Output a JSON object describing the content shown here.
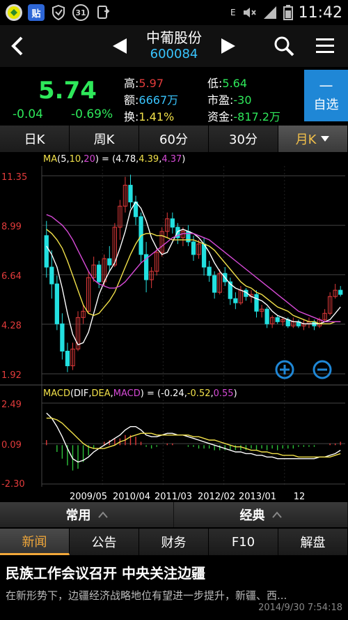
{
  "statusbar": {
    "time": "11:42",
    "notif_count": "31",
    "app_icon_text": "贴",
    "e_label": "E"
  },
  "title": {
    "stock_name": "中葡股份",
    "stock_code": "600084"
  },
  "quote": {
    "price": "5.74",
    "change": "-0.04",
    "change_pct": "-0.69%",
    "high_label": "高:",
    "high": "5.97",
    "low_label": "低:",
    "low": "5.64",
    "amount_label": "额:",
    "amount": "6667万",
    "pe_label": "市盈:",
    "pe": "-30",
    "turnover_label": "换:",
    "turnover": "1.41%",
    "fund_label": "资金:",
    "fund": "-817.2万",
    "zixuan_dash": "—",
    "zixuan_label": "自选"
  },
  "period_tabs": [
    "日K",
    "周K",
    "60分",
    "30分",
    "月K"
  ],
  "active_period": "月K",
  "colors": {
    "up": "#e23b3b",
    "down": "#23e0e0",
    "green": "#2ee85a",
    "accent": "#f2c04a",
    "blue": "#1f87d6"
  },
  "chart_data": [
    {
      "type": "candlestick",
      "title": "MA(5,10,20) = (4.78,4.39,4.37)",
      "ma_label": "MA",
      "ma_params": [
        "5",
        "10",
        "20"
      ],
      "ma_values": [
        "4.78",
        "4.39",
        "4.37"
      ],
      "y_ticks": [
        "11.35",
        "8.99",
        "6.64",
        "4.28",
        "1.92"
      ],
      "ylim": [
        1.92,
        11.35
      ],
      "x_ticks": [
        "2009/05",
        "2010/04",
        "2011/03",
        "2012/02",
        "2013/01",
        "12"
      ],
      "candles": [
        [
          8.5,
          9.2,
          6.5,
          7.0
        ],
        [
          7.0,
          7.8,
          5.5,
          6.2
        ],
        [
          6.2,
          6.6,
          4.0,
          4.3
        ],
        [
          4.3,
          4.8,
          2.6,
          3.0
        ],
        [
          3.0,
          3.4,
          2.0,
          2.3
        ],
        [
          2.3,
          3.4,
          2.1,
          3.1
        ],
        [
          3.1,
          4.9,
          3.0,
          4.6
        ],
        [
          4.6,
          5.2,
          4.3,
          4.9
        ],
        [
          4.9,
          6.8,
          4.8,
          6.5
        ],
        [
          6.5,
          7.5,
          6.3,
          7.1
        ],
        [
          7.1,
          7.3,
          6.0,
          6.3
        ],
        [
          6.3,
          7.6,
          6.1,
          7.4
        ],
        [
          7.4,
          8.0,
          6.8,
          7.1
        ],
        [
          7.1,
          9.1,
          7.0,
          8.9
        ],
        [
          8.9,
          10.2,
          8.3,
          9.9
        ],
        [
          9.9,
          11.3,
          9.6,
          10.9
        ],
        [
          10.9,
          11.4,
          9.8,
          10.1
        ],
        [
          10.1,
          10.4,
          9.0,
          9.4
        ],
        [
          9.4,
          9.6,
          7.2,
          7.6
        ],
        [
          7.6,
          8.2,
          5.8,
          6.4
        ],
        [
          6.4,
          7.0,
          6.0,
          6.8
        ],
        [
          6.8,
          7.9,
          6.6,
          7.7
        ],
        [
          7.7,
          8.9,
          7.5,
          8.7
        ],
        [
          8.7,
          9.6,
          8.4,
          9.3
        ],
        [
          9.3,
          9.6,
          8.6,
          8.9
        ],
        [
          8.9,
          9.1,
          8.1,
          8.4
        ],
        [
          8.4,
          8.9,
          8.0,
          8.7
        ],
        [
          8.7,
          9.0,
          8.0,
          8.2
        ],
        [
          8.2,
          8.5,
          7.3,
          7.6
        ],
        [
          7.6,
          8.3,
          7.4,
          8.1
        ],
        [
          8.1,
          8.4,
          6.6,
          7.0
        ],
        [
          7.0,
          7.3,
          6.3,
          6.6
        ],
        [
          6.6,
          6.8,
          5.5,
          5.8
        ],
        [
          5.8,
          6.9,
          5.7,
          6.7
        ],
        [
          6.7,
          7.0,
          6.1,
          6.3
        ],
        [
          6.3,
          6.5,
          5.2,
          5.5
        ],
        [
          5.5,
          5.8,
          5.0,
          5.3
        ],
        [
          5.3,
          6.1,
          5.2,
          5.9
        ],
        [
          5.9,
          6.0,
          5.4,
          5.6
        ],
        [
          5.6,
          5.9,
          5.3,
          5.7
        ],
        [
          5.7,
          5.9,
          4.6,
          4.9
        ],
        [
          4.9,
          5.2,
          4.6,
          5.0
        ],
        [
          5.0,
          5.1,
          4.1,
          4.3
        ],
        [
          4.3,
          4.7,
          4.1,
          4.6
        ],
        [
          4.6,
          4.7,
          4.3,
          4.4
        ],
        [
          4.4,
          4.6,
          4.2,
          4.5
        ],
        [
          4.5,
          4.6,
          4.1,
          4.2
        ],
        [
          4.2,
          4.6,
          4.1,
          4.4
        ],
        [
          4.4,
          4.5,
          4.1,
          4.2
        ],
        [
          4.2,
          4.5,
          4.0,
          4.3
        ],
        [
          4.3,
          4.6,
          4.1,
          4.4
        ],
        [
          4.4,
          4.5,
          4.0,
          4.2
        ],
        [
          4.2,
          4.6,
          4.1,
          4.5
        ],
        [
          4.5,
          5.0,
          4.4,
          4.8
        ],
        [
          4.8,
          5.8,
          4.7,
          5.6
        ],
        [
          5.6,
          6.2,
          5.5,
          5.9
        ],
        [
          5.9,
          6.1,
          5.6,
          5.7
        ]
      ],
      "ma5": [
        8.0,
        7.6,
        7.0,
        6.0,
        4.8,
        3.8,
        3.3,
        3.4,
        3.9,
        4.8,
        5.7,
        6.3,
        6.8,
        7.2,
        7.9,
        8.7,
        9.7,
        10.1,
        9.8,
        9.2,
        8.4,
        7.9,
        7.6,
        7.7,
        8.2,
        8.7,
        8.8,
        8.7,
        8.6,
        8.4,
        8.1,
        7.7,
        7.2,
        6.8,
        6.5,
        6.2,
        6.0,
        5.9,
        5.8,
        5.6,
        5.5,
        5.4,
        5.2,
        4.9,
        4.7,
        4.6,
        4.5,
        4.4,
        4.4,
        4.3,
        4.3,
        4.3,
        4.3,
        4.4,
        4.5,
        4.8,
        5.1
      ],
      "ma10": [
        8.8,
        8.6,
        8.3,
        7.9,
        7.3,
        6.6,
        5.9,
        5.2,
        4.8,
        4.7,
        4.8,
        5.1,
        5.4,
        5.8,
        6.4,
        7.0,
        7.6,
        8.1,
        8.5,
        8.6,
        8.6,
        8.5,
        8.5,
        8.4,
        8.3,
        8.3,
        8.3,
        8.3,
        8.3,
        8.2,
        8.1,
        8.0,
        7.8,
        7.5,
        7.2,
        6.9,
        6.6,
        6.3,
        6.1,
        6.0,
        5.8,
        5.7,
        5.5,
        5.3,
        5.1,
        5.0,
        4.9,
        4.7,
        4.6,
        4.5,
        4.4,
        4.4,
        4.3,
        4.3,
        4.3,
        4.4,
        4.4
      ],
      "ma20": [
        9.5,
        9.4,
        9.2,
        9.0,
        8.7,
        8.3,
        7.8,
        7.3,
        6.8,
        6.4,
        6.2,
        6.1,
        6.0,
        6.0,
        6.1,
        6.3,
        6.6,
        6.9,
        7.2,
        7.4,
        7.6,
        7.8,
        8.0,
        8.2,
        8.4,
        8.5,
        8.6,
        8.6,
        8.6,
        8.5,
        8.4,
        8.3,
        8.1,
        7.9,
        7.7,
        7.5,
        7.3,
        7.1,
        6.9,
        6.7,
        6.5,
        6.3,
        6.1,
        5.9,
        5.7,
        5.5,
        5.3,
        5.1,
        4.9,
        4.8,
        4.7,
        4.6,
        4.5,
        4.4,
        4.4,
        4.4,
        4.4
      ]
    },
    {
      "type": "macd",
      "title": "MACD(DIF,DEA,MACD) = (-0.24,-0.52,0.55)",
      "macd_label": "MACD",
      "macd_params": [
        "DIF",
        "DEA",
        "MACD"
      ],
      "macd_values": [
        "-0.24",
        "-0.52",
        "0.55"
      ],
      "y_ticks": [
        "2.49",
        "0.09",
        "-2.30"
      ],
      "ylim": [
        -2.3,
        2.49
      ],
      "dif": [
        1.9,
        1.6,
        1.1,
        0.5,
        -0.2,
        -0.8,
        -1.0,
        -0.9,
        -0.7,
        -0.4,
        -0.2,
        0.0,
        0.2,
        0.4,
        0.6,
        0.9,
        1.1,
        1.1,
        0.9,
        0.6,
        0.5,
        0.5,
        0.6,
        0.7,
        0.7,
        0.6,
        0.6,
        0.5,
        0.4,
        0.3,
        0.2,
        0.1,
        0.0,
        -0.1,
        -0.2,
        -0.3,
        -0.4,
        -0.4,
        -0.5,
        -0.5,
        -0.6,
        -0.6,
        -0.7,
        -0.7,
        -0.8,
        -0.8,
        -0.8,
        -0.8,
        -0.8,
        -0.8,
        -0.8,
        -0.8,
        -0.7,
        -0.7,
        -0.6,
        -0.5,
        -0.3
      ],
      "dea": [
        1.6,
        1.6,
        1.5,
        1.3,
        1.0,
        0.7,
        0.4,
        0.1,
        -0.1,
        -0.2,
        -0.2,
        -0.2,
        -0.1,
        0.0,
        0.2,
        0.3,
        0.5,
        0.6,
        0.7,
        0.7,
        0.7,
        0.6,
        0.6,
        0.6,
        0.6,
        0.6,
        0.6,
        0.6,
        0.5,
        0.5,
        0.4,
        0.3,
        0.3,
        0.2,
        0.1,
        0.0,
        -0.1,
        -0.1,
        -0.2,
        -0.3,
        -0.3,
        -0.4,
        -0.4,
        -0.5,
        -0.5,
        -0.6,
        -0.6,
        -0.6,
        -0.7,
        -0.7,
        -0.7,
        -0.7,
        -0.7,
        -0.7,
        -0.7,
        -0.6,
        -0.5
      ],
      "hist": [
        0.3,
        0.0,
        -0.4,
        -0.8,
        -1.2,
        -1.5,
        -1.4,
        -1.0,
        -0.6,
        -0.2,
        0.0,
        0.2,
        0.3,
        0.4,
        0.4,
        0.6,
        0.6,
        0.5,
        0.2,
        -0.1,
        -0.2,
        -0.1,
        0.0,
        0.1,
        0.1,
        0.0,
        0.0,
        -0.1,
        -0.1,
        -0.2,
        -0.2,
        -0.2,
        -0.3,
        -0.3,
        -0.3,
        -0.3,
        -0.3,
        -0.3,
        -0.3,
        -0.2,
        -0.3,
        -0.2,
        -0.3,
        -0.2,
        -0.3,
        -0.2,
        -0.2,
        -0.2,
        -0.1,
        -0.1,
        -0.1,
        -0.1,
        0.0,
        0.0,
        0.1,
        0.1,
        0.2
      ]
    }
  ],
  "bottom_toggles": [
    {
      "label": "常用"
    },
    {
      "label": "经典"
    }
  ],
  "news_tabs": [
    "新闻",
    "公告",
    "财务",
    "F10",
    "解盘"
  ],
  "active_news_tab": "新闻",
  "news": {
    "title": "民族工作会议召开 中央关注边疆",
    "summary": "在新形势下，边疆经济战略地位有望进一步提升，新疆、西...",
    "time": "2014/9/30 7:54:18"
  }
}
